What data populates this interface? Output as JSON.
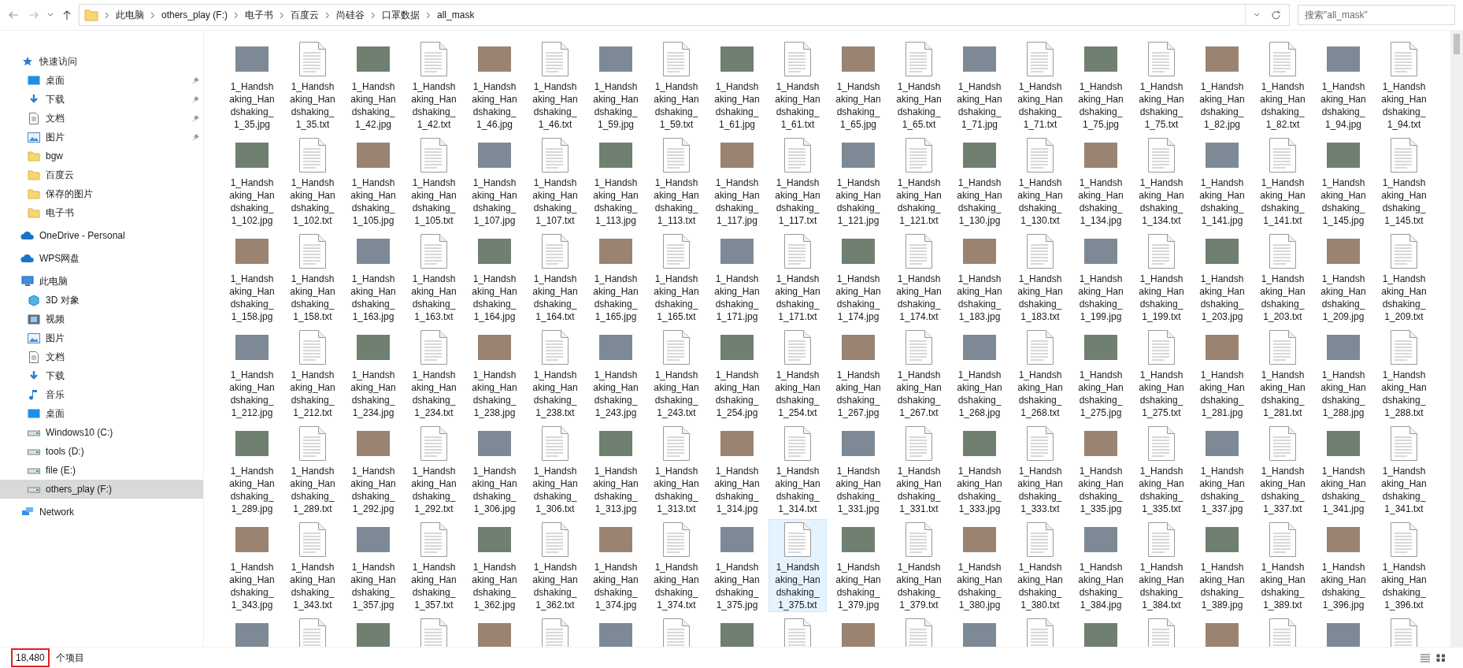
{
  "toolbar": {
    "breadcrumb": [
      "此电脑",
      "others_play (F:)",
      "电子书",
      "百度云",
      "尚硅谷",
      "口罩数据",
      "all_mask"
    ],
    "search": {
      "placeholder": "搜索\"all_mask\""
    }
  },
  "sidebar": {
    "sections": [
      {
        "label": "快速访问",
        "kind": "star",
        "selected": false,
        "children": [
          {
            "label": "桌面",
            "kind": "desktop",
            "pinned": true,
            "selected": false
          },
          {
            "label": "下载",
            "kind": "download",
            "pinned": true,
            "selected": false
          },
          {
            "label": "文档",
            "kind": "document",
            "pinned": true,
            "selected": false
          },
          {
            "label": "图片",
            "kind": "picture",
            "pinned": true,
            "selected": false
          },
          {
            "label": "bgw",
            "kind": "folder",
            "pinned": false,
            "selected": false
          },
          {
            "label": "百度云",
            "kind": "folder",
            "pinned": false,
            "selected": false
          },
          {
            "label": "保存的图片",
            "kind": "folder",
            "pinned": false,
            "selected": false
          },
          {
            "label": "电子书",
            "kind": "folder",
            "pinned": false,
            "selected": false
          }
        ]
      },
      {
        "label": "OneDrive - Personal",
        "kind": "cloud",
        "selected": false
      },
      {
        "label": "WPS网盘",
        "kind": "cloud",
        "selected": false
      },
      {
        "label": "此电脑",
        "kind": "computer",
        "selected": false,
        "children": [
          {
            "label": "3D 对象",
            "kind": "cube",
            "pinned": false,
            "selected": false
          },
          {
            "label": "视频",
            "kind": "video",
            "pinned": false,
            "selected": false
          },
          {
            "label": "图片",
            "kind": "picture",
            "pinned": false,
            "selected": false
          },
          {
            "label": "文档",
            "kind": "document",
            "pinned": false,
            "selected": false
          },
          {
            "label": "下载",
            "kind": "download",
            "pinned": false,
            "selected": false
          },
          {
            "label": "音乐",
            "kind": "music",
            "pinned": false,
            "selected": false
          },
          {
            "label": "桌面",
            "kind": "desktop",
            "pinned": false,
            "selected": false
          },
          {
            "label": "Windows10 (C:)",
            "kind": "drive",
            "pinned": false,
            "selected": false
          },
          {
            "label": "tools (D:)",
            "kind": "drive",
            "pinned": false,
            "selected": false
          },
          {
            "label": "file (E:)",
            "kind": "drive",
            "pinned": false,
            "selected": false
          },
          {
            "label": "others_play (F:)",
            "kind": "drive",
            "pinned": false,
            "selected": true
          }
        ]
      },
      {
        "label": "Network",
        "kind": "network",
        "selected": false
      }
    ]
  },
  "files": [
    {
      "name": "1_Handshaking_Handshaking_1_35.jpg",
      "kind": "photo",
      "selected": false
    },
    {
      "name": "1_Handshaking_Handshaking_1_35.txt",
      "kind": "text",
      "selected": false
    },
    {
      "name": "1_Handshaking_Handshaking_1_42.jpg",
      "kind": "photo",
      "selected": false
    },
    {
      "name": "1_Handshaking_Handshaking_1_42.txt",
      "kind": "text",
      "selected": false
    },
    {
      "name": "1_Handshaking_Handshaking_1_46.jpg",
      "kind": "photo",
      "selected": false
    },
    {
      "name": "1_Handshaking_Handshaking_1_46.txt",
      "kind": "text",
      "selected": false
    },
    {
      "name": "1_Handshaking_Handshaking_1_59.jpg",
      "kind": "photo",
      "selected": false
    },
    {
      "name": "1_Handshaking_Handshaking_1_59.txt",
      "kind": "text",
      "selected": false
    },
    {
      "name": "1_Handshaking_Handshaking_1_61.jpg",
      "kind": "photo",
      "selected": false
    },
    {
      "name": "1_Handshaking_Handshaking_1_61.txt",
      "kind": "text",
      "selected": false
    },
    {
      "name": "1_Handshaking_Handshaking_1_65.jpg",
      "kind": "photo",
      "selected": false
    },
    {
      "name": "1_Handshaking_Handshaking_1_65.txt",
      "kind": "text",
      "selected": false
    },
    {
      "name": "1_Handshaking_Handshaking_1_71.jpg",
      "kind": "photo",
      "selected": false
    },
    {
      "name": "1_Handshaking_Handshaking_1_71.txt",
      "kind": "text",
      "selected": false
    },
    {
      "name": "1_Handshaking_Handshaking_1_75.jpg",
      "kind": "photo",
      "selected": false
    },
    {
      "name": "1_Handshaking_Handshaking_1_75.txt",
      "kind": "text",
      "selected": false
    },
    {
      "name": "1_Handshaking_Handshaking_1_82.jpg",
      "kind": "photo",
      "selected": false
    },
    {
      "name": "1_Handshaking_Handshaking_1_82.txt",
      "kind": "text",
      "selected": false
    },
    {
      "name": "1_Handshaking_Handshaking_1_94.jpg",
      "kind": "photo",
      "selected": false
    },
    {
      "name": "1_Handshaking_Handshaking_1_94.txt",
      "kind": "text",
      "selected": false
    },
    {
      "name": "1_Handshaking_Handshaking_1_102.jpg",
      "kind": "photo",
      "selected": false
    },
    {
      "name": "1_Handshaking_Handshaking_1_102.txt",
      "kind": "text",
      "selected": false
    },
    {
      "name": "1_Handshaking_Handshaking_1_105.jpg",
      "kind": "photo",
      "selected": false
    },
    {
      "name": "1_Handshaking_Handshaking_1_105.txt",
      "kind": "text",
      "selected": false
    },
    {
      "name": "1_Handshaking_Handshaking_1_107.jpg",
      "kind": "photo",
      "selected": false
    },
    {
      "name": "1_Handshaking_Handshaking_1_107.txt",
      "kind": "text",
      "selected": false
    },
    {
      "name": "1_Handshaking_Handshaking_1_113.jpg",
      "kind": "photo",
      "selected": false
    },
    {
      "name": "1_Handshaking_Handshaking_1_113.txt",
      "kind": "text",
      "selected": false
    },
    {
      "name": "1_Handshaking_Handshaking_1_117.jpg",
      "kind": "photo",
      "selected": false
    },
    {
      "name": "1_Handshaking_Handshaking_1_117.txt",
      "kind": "text",
      "selected": false
    },
    {
      "name": "1_Handshaking_Handshaking_1_121.jpg",
      "kind": "photo",
      "selected": false
    },
    {
      "name": "1_Handshaking_Handshaking_1_121.txt",
      "kind": "text",
      "selected": false
    },
    {
      "name": "1_Handshaking_Handshaking_1_130.jpg",
      "kind": "photo",
      "selected": false
    },
    {
      "name": "1_Handshaking_Handshaking_1_130.txt",
      "kind": "text",
      "selected": false
    },
    {
      "name": "1_Handshaking_Handshaking_1_134.jpg",
      "kind": "photo",
      "selected": false
    },
    {
      "name": "1_Handshaking_Handshaking_1_134.txt",
      "kind": "text",
      "selected": false
    },
    {
      "name": "1_Handshaking_Handshaking_1_141.jpg",
      "kind": "photo",
      "selected": false
    },
    {
      "name": "1_Handshaking_Handshaking_1_141.txt",
      "kind": "text",
      "selected": false
    },
    {
      "name": "1_Handshaking_Handshaking_1_145.jpg",
      "kind": "photo",
      "selected": false
    },
    {
      "name": "1_Handshaking_Handshaking_1_145.txt",
      "kind": "text",
      "selected": false
    },
    {
      "name": "1_Handshaking_Handshaking_1_158.jpg",
      "kind": "photo",
      "selected": false
    },
    {
      "name": "1_Handshaking_Handshaking_1_158.txt",
      "kind": "text",
      "selected": false
    },
    {
      "name": "1_Handshaking_Handshaking_1_163.jpg",
      "kind": "photo",
      "selected": false
    },
    {
      "name": "1_Handshaking_Handshaking_1_163.txt",
      "kind": "text",
      "selected": false
    },
    {
      "name": "1_Handshaking_Handshaking_1_164.jpg",
      "kind": "photo",
      "selected": false
    },
    {
      "name": "1_Handshaking_Handshaking_1_164.txt",
      "kind": "text",
      "selected": false
    },
    {
      "name": "1_Handshaking_Handshaking_1_165.jpg",
      "kind": "photo",
      "selected": false
    },
    {
      "name": "1_Handshaking_Handshaking_1_165.txt",
      "kind": "text",
      "selected": false
    },
    {
      "name": "1_Handshaking_Handshaking_1_171.jpg",
      "kind": "photo",
      "selected": false
    },
    {
      "name": "1_Handshaking_Handshaking_1_171.txt",
      "kind": "text",
      "selected": false
    },
    {
      "name": "1_Handshaking_Handshaking_1_174.jpg",
      "kind": "photo",
      "selected": false
    },
    {
      "name": "1_Handshaking_Handshaking_1_174.txt",
      "kind": "text",
      "selected": false
    },
    {
      "name": "1_Handshaking_Handshaking_1_183.jpg",
      "kind": "photo",
      "selected": false
    },
    {
      "name": "1_Handshaking_Handshaking_1_183.txt",
      "kind": "text",
      "selected": false
    },
    {
      "name": "1_Handshaking_Handshaking_1_199.jpg",
      "kind": "photo",
      "selected": false
    },
    {
      "name": "1_Handshaking_Handshaking_1_199.txt",
      "kind": "text",
      "selected": false
    },
    {
      "name": "1_Handshaking_Handshaking_1_203.jpg",
      "kind": "photo",
      "selected": false
    },
    {
      "name": "1_Handshaking_Handshaking_1_203.txt",
      "kind": "text",
      "selected": false
    },
    {
      "name": "1_Handshaking_Handshaking_1_209.jpg",
      "kind": "photo",
      "selected": false
    },
    {
      "name": "1_Handshaking_Handshaking_1_209.txt",
      "kind": "text",
      "selected": false
    },
    {
      "name": "1_Handshaking_Handshaking_1_212.jpg",
      "kind": "photo",
      "selected": false
    },
    {
      "name": "1_Handshaking_Handshaking_1_212.txt",
      "kind": "text",
      "selected": false
    },
    {
      "name": "1_Handshaking_Handshaking_1_234.jpg",
      "kind": "photo",
      "selected": false
    },
    {
      "name": "1_Handshaking_Handshaking_1_234.txt",
      "kind": "text",
      "selected": false
    },
    {
      "name": "1_Handshaking_Handshaking_1_238.jpg",
      "kind": "photo",
      "selected": false
    },
    {
      "name": "1_Handshaking_Handshaking_1_238.txt",
      "kind": "text",
      "selected": false
    },
    {
      "name": "1_Handshaking_Handshaking_1_243.jpg",
      "kind": "photo",
      "selected": false
    },
    {
      "name": "1_Handshaking_Handshaking_1_243.txt",
      "kind": "text",
      "selected": false
    },
    {
      "name": "1_Handshaking_Handshaking_1_254.jpg",
      "kind": "photo",
      "selected": false
    },
    {
      "name": "1_Handshaking_Handshaking_1_254.txt",
      "kind": "text",
      "selected": false
    },
    {
      "name": "1_Handshaking_Handshaking_1_267.jpg",
      "kind": "photo",
      "selected": false
    },
    {
      "name": "1_Handshaking_Handshaking_1_267.txt",
      "kind": "text",
      "selected": false
    },
    {
      "name": "1_Handshaking_Handshaking_1_268.jpg",
      "kind": "photo",
      "selected": false
    },
    {
      "name": "1_Handshaking_Handshaking_1_268.txt",
      "kind": "text",
      "selected": false
    },
    {
      "name": "1_Handshaking_Handshaking_1_275.jpg",
      "kind": "photo",
      "selected": false
    },
    {
      "name": "1_Handshaking_Handshaking_1_275.txt",
      "kind": "text",
      "selected": false
    },
    {
      "name": "1_Handshaking_Handshaking_1_281.jpg",
      "kind": "photo",
      "selected": false
    },
    {
      "name": "1_Handshaking_Handshaking_1_281.txt",
      "kind": "text",
      "selected": false
    },
    {
      "name": "1_Handshaking_Handshaking_1_288.jpg",
      "kind": "photo",
      "selected": false
    },
    {
      "name": "1_Handshaking_Handshaking_1_288.txt",
      "kind": "text",
      "selected": false
    },
    {
      "name": "1_Handshaking_Handshaking_1_289.jpg",
      "kind": "photo",
      "selected": false
    },
    {
      "name": "1_Handshaking_Handshaking_1_289.txt",
      "kind": "text",
      "selected": false
    },
    {
      "name": "1_Handshaking_Handshaking_1_292.jpg",
      "kind": "photo",
      "selected": false
    },
    {
      "name": "1_Handshaking_Handshaking_1_292.txt",
      "kind": "text",
      "selected": false
    },
    {
      "name": "1_Handshaking_Handshaking_1_306.jpg",
      "kind": "photo",
      "selected": false
    },
    {
      "name": "1_Handshaking_Handshaking_1_306.txt",
      "kind": "text",
      "selected": false
    },
    {
      "name": "1_Handshaking_Handshaking_1_313.jpg",
      "kind": "photo",
      "selected": false
    },
    {
      "name": "1_Handshaking_Handshaking_1_313.txt",
      "kind": "text",
      "selected": false
    },
    {
      "name": "1_Handshaking_Handshaking_1_314.jpg",
      "kind": "photo",
      "selected": false
    },
    {
      "name": "1_Handshaking_Handshaking_1_314.txt",
      "kind": "text",
      "selected": false
    },
    {
      "name": "1_Handshaking_Handshaking_1_331.jpg",
      "kind": "photo",
      "selected": false
    },
    {
      "name": "1_Handshaking_Handshaking_1_331.txt",
      "kind": "text",
      "selected": false
    },
    {
      "name": "1_Handshaking_Handshaking_1_333.jpg",
      "kind": "photo",
      "selected": false
    },
    {
      "name": "1_Handshaking_Handshaking_1_333.txt",
      "kind": "text",
      "selected": false
    },
    {
      "name": "1_Handshaking_Handshaking_1_335.jpg",
      "kind": "photo",
      "selected": false
    },
    {
      "name": "1_Handshaking_Handshaking_1_335.txt",
      "kind": "text",
      "selected": false
    },
    {
      "name": "1_Handshaking_Handshaking_1_337.jpg",
      "kind": "photo",
      "selected": false
    },
    {
      "name": "1_Handshaking_Handshaking_1_337.txt",
      "kind": "text",
      "selected": false
    },
    {
      "name": "1_Handshaking_Handshaking_1_341.jpg",
      "kind": "photo",
      "selected": false
    },
    {
      "name": "1_Handshaking_Handshaking_1_341.txt",
      "kind": "text",
      "selected": false
    },
    {
      "name": "1_Handshaking_Handshaking_1_343.jpg",
      "kind": "photo",
      "selected": false
    },
    {
      "name": "1_Handshaking_Handshaking_1_343.txt",
      "kind": "text",
      "selected": false
    },
    {
      "name": "1_Handshaking_Handshaking_1_357.jpg",
      "kind": "photo",
      "selected": false
    },
    {
      "name": "1_Handshaking_Handshaking_1_357.txt",
      "kind": "text",
      "selected": false
    },
    {
      "name": "1_Handshaking_Handshaking_1_362.jpg",
      "kind": "photo",
      "selected": false
    },
    {
      "name": "1_Handshaking_Handshaking_1_362.txt",
      "kind": "text",
      "selected": false
    },
    {
      "name": "1_Handshaking_Handshaking_1_374.jpg",
      "kind": "photo",
      "selected": false
    },
    {
      "name": "1_Handshaking_Handshaking_1_374.txt",
      "kind": "text",
      "selected": false
    },
    {
      "name": "1_Handshaking_Handshaking_1_375.jpg",
      "kind": "photo",
      "selected": false
    },
    {
      "name": "1_Handshaking_Handshaking_1_375.txt",
      "kind": "text",
      "selected": true
    },
    {
      "name": "1_Handshaking_Handshaking_1_379.jpg",
      "kind": "photo",
      "selected": false
    },
    {
      "name": "1_Handshaking_Handshaking_1_379.txt",
      "kind": "text",
      "selected": false
    },
    {
      "name": "1_Handshaking_Handshaking_1_380.jpg",
      "kind": "photo",
      "selected": false
    },
    {
      "name": "1_Handshaking_Handshaking_1_380.txt",
      "kind": "text",
      "selected": false
    },
    {
      "name": "1_Handshaking_Handshaking_1_384.jpg",
      "kind": "photo",
      "selected": false
    },
    {
      "name": "1_Handshaking_Handshaking_1_384.txt",
      "kind": "text",
      "selected": false
    },
    {
      "name": "1_Handshaking_Handshaking_1_389.jpg",
      "kind": "photo",
      "selected": false
    },
    {
      "name": "1_Handshaking_Handshaking_1_389.txt",
      "kind": "text",
      "selected": false
    },
    {
      "name": "1_Handshaking_Handshaking_1_396.jpg",
      "kind": "photo",
      "selected": false
    },
    {
      "name": "1_Handshaking_Handshaking_1_396.txt",
      "kind": "text",
      "selected": false
    },
    {
      "kind": "photo",
      "selected": false
    },
    {
      "kind": "text",
      "selected": false
    },
    {
      "kind": "photo",
      "selected": false
    },
    {
      "kind": "text",
      "selected": false
    },
    {
      "kind": "photo",
      "selected": false
    },
    {
      "kind": "text",
      "selected": false
    },
    {
      "kind": "photo",
      "selected": false
    },
    {
      "kind": "text",
      "selected": false
    },
    {
      "kind": "photo",
      "selected": false
    },
    {
      "kind": "text",
      "selected": false
    },
    {
      "kind": "photo",
      "selected": false
    },
    {
      "kind": "text",
      "selected": false
    },
    {
      "kind": "photo",
      "selected": false
    },
    {
      "kind": "text",
      "selected": false
    },
    {
      "kind": "photo",
      "selected": false
    },
    {
      "kind": "text",
      "selected": false
    },
    {
      "kind": "photo",
      "selected": false
    },
    {
      "kind": "text",
      "selected": false
    },
    {
      "kind": "photo",
      "selected": false
    },
    {
      "kind": "text",
      "selected": false
    }
  ],
  "status_bar": {
    "count": "18,480",
    "count_highlighted": true,
    "unit": "个项目"
  }
}
